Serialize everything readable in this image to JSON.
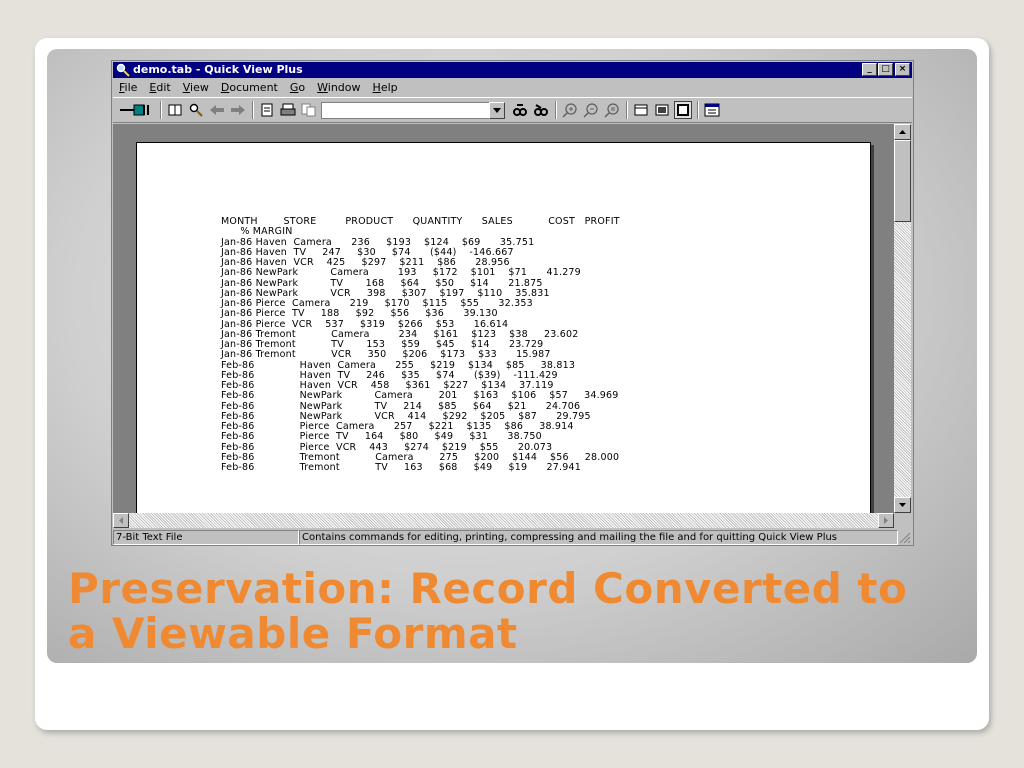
{
  "slide": {
    "title_line1": "Preservation: Record Converted to",
    "title_line2": "a Viewable Format"
  },
  "window": {
    "title": "demo.tab - Quick View Plus",
    "minimize": "_",
    "maximize": "□",
    "close": "×"
  },
  "menu": [
    {
      "pre": "",
      "u": "F",
      "post": "ile"
    },
    {
      "pre": "",
      "u": "E",
      "post": "dit"
    },
    {
      "pre": "",
      "u": "V",
      "post": "iew"
    },
    {
      "pre": "",
      "u": "D",
      "post": "ocument"
    },
    {
      "pre": "",
      "u": "G",
      "post": "o"
    },
    {
      "pre": "",
      "u": "W",
      "post": "indow"
    },
    {
      "pre": "",
      "u": "H",
      "post": "elp"
    }
  ],
  "toolbar": {
    "combo_value": "",
    "icons": [
      "launch-icon",
      "single-page-icon",
      "find-icon",
      "back-icon",
      "forward-icon",
      "document-icon",
      "print-icon",
      "copy-icon",
      "combo",
      "search-next-icon",
      "search-prev-icon",
      "zoom-in-icon",
      "zoom-out-icon",
      "zoom-reset-icon",
      "view-normal-icon",
      "view-draft-icon",
      "view-page-icon",
      "properties-icon"
    ]
  },
  "document": {
    "lines": [
      "MONTH        STORE         PRODUCT      QUANTITY      SALES           COST   PROFIT",
      "      % MARGIN",
      "Jan-86 Haven  Camera      236     $193    $124    $69      35.751",
      "Jan-86 Haven  TV     247     $30     $74      ($44)    -146.667",
      "Jan-86 Haven  VCR    425     $297    $211    $86      28.956",
      "Jan-86 NewPark          Camera         193     $172    $101    $71      41.279",
      "Jan-86 NewPark          TV       168     $64     $50     $14      21.875",
      "Jan-86 NewPark          VCR     398     $307    $197    $110    35.831",
      "Jan-86 Pierce  Camera      219     $170    $115    $55      32.353",
      "Jan-86 Pierce  TV     188     $92     $56     $36      39.130",
      "Jan-86 Pierce  VCR    537     $319    $266    $53      16.614",
      "Jan-86 Tremont           Camera         234     $161    $123    $38     23.602",
      "Jan-86 Tremont           TV       153     $59     $45     $14      23.729",
      "Jan-86 Tremont           VCR     350     $206    $173    $33      15.987",
      "Feb-86              Haven  Camera      255     $219    $134    $85     38.813",
      "Feb-86              Haven  TV     246     $35     $74      ($39)    -111.429",
      "Feb-86              Haven  VCR    458     $361    $227    $134    37.119",
      "Feb-86              NewPark          Camera        201     $163    $106    $57     34.969",
      "Feb-86              NewPark          TV     214     $85     $64     $21      24.706",
      "Feb-86              NewPark          VCR    414     $292    $205    $87      29.795",
      "Feb-86              Pierce  Camera      257     $221    $135    $86     38.914",
      "Feb-86              Pierce  TV     164     $80     $49     $31      38.750",
      "Feb-86              Pierce  VCR    443     $274    $219    $55      20.073",
      "Feb-86              Tremont           Camera        275     $200    $144    $56     28.000",
      "Feb-86              Tremont           TV     163     $68     $49     $19      27.941"
    ]
  },
  "status": {
    "left": "7-Bit Text File",
    "right": "Contains commands for editing, printing, compressing and mailing the file and for quitting Quick View Plus"
  },
  "colors": {
    "title_accent": "#f08a32",
    "titlebar": "#000080"
  }
}
